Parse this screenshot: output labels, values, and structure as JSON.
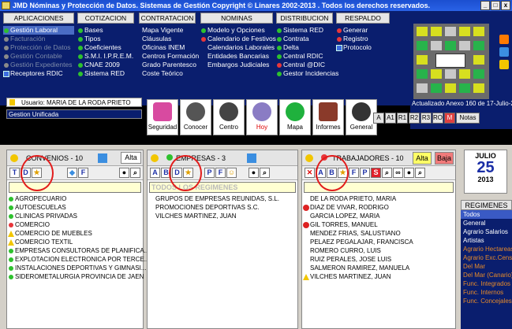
{
  "window": {
    "title": "JMD Nóminas y Protección de Datos. Sistemas de Gestión   Copyright © Linares 2002-2013 . Todos los derechos reservados."
  },
  "menus": [
    {
      "header": "APLICACIONES",
      "items": [
        {
          "label": "Gestión Laboral",
          "state": "selected"
        },
        {
          "label": "Facturación",
          "state": "disabled"
        },
        {
          "label": "Protección de Datos",
          "state": "disabled"
        },
        {
          "label": "Gestión Contable",
          "state": "disabled"
        },
        {
          "label": "Gestión Expedientes",
          "state": "disabled"
        },
        {
          "label": "Receptores RDIC",
          "state": "normal"
        }
      ]
    },
    {
      "header": "COTIZACION",
      "items": [
        {
          "label": "Bases"
        },
        {
          "label": "Tipos"
        },
        {
          "label": "Coeficientes"
        },
        {
          "label": "S.M.I. I.P.R.E.M."
        },
        {
          "label": "CNAE 2009"
        },
        {
          "label": "Sistema RED"
        }
      ]
    },
    {
      "header": "CONTRATACION",
      "items": [
        {
          "label": "Mapa Vigente"
        },
        {
          "label": "Cláusulas"
        },
        {
          "label": "Oficinas INEM"
        },
        {
          "label": "Centros Formación"
        },
        {
          "label": "Grado Parentesco"
        },
        {
          "label": "Coste Teórico"
        }
      ]
    },
    {
      "header": "NOMINAS",
      "items": [
        {
          "label": "Modelo y Opciones"
        },
        {
          "label": "Calendario de Festivos"
        },
        {
          "label": "Calendarios Laborales"
        },
        {
          "label": "Entidades Bancarias"
        },
        {
          "label": "Embargos Judiciales"
        }
      ]
    },
    {
      "header": "DISTRIBUCION",
      "items": [
        {
          "label": "Sistema RED"
        },
        {
          "label": "Contrata"
        },
        {
          "label": "Delta"
        },
        {
          "label": "Central  RDIC"
        },
        {
          "label": "Central  @DIC"
        },
        {
          "label": "Gestor Incidencias"
        }
      ]
    },
    {
      "header": "RESPALDO",
      "items": [
        {
          "label": "Generar"
        },
        {
          "label": "Registro"
        },
        {
          "label": "Protocolo"
        }
      ]
    }
  ],
  "user": {
    "label": "Usuario: MARIA DE LA RODA PRIETO"
  },
  "company": "Gestion Unificada",
  "toolbar": [
    {
      "label": "Seguridad"
    },
    {
      "label": "Conocer"
    },
    {
      "label": "Centro"
    },
    {
      "label": "Hoy"
    },
    {
      "label": "Mapa"
    },
    {
      "label": "Informes"
    },
    {
      "label": "General"
    }
  ],
  "annex": "Actualizado Anexo 160 de 17-Julio-2013",
  "rightbuttons": [
    "A",
    "A1",
    "R1",
    "R2",
    "R3",
    "RO",
    "M",
    "Notas"
  ],
  "panels": {
    "convenios": {
      "title": "CONVENIOS - 10",
      "alta": "Alta",
      "rows": [
        {
          "t": "AGROPECUARIO",
          "i": "g"
        },
        {
          "t": "AUTOESCUELAS",
          "i": "g"
        },
        {
          "t": "CLINICAS PRIVADAS",
          "i": "g"
        },
        {
          "t": "COMERCIO",
          "i": "r"
        },
        {
          "t": "COMERCIO DE MUEBLES",
          "i": "w"
        },
        {
          "t": "COMERCIO TEXTIL",
          "i": "w"
        },
        {
          "t": "EMPRESAS CONSULTORAS DE PLANIFICA...",
          "i": "g"
        },
        {
          "t": "EXPLOTACION ELECTRONICA POR TERCE...",
          "i": "g"
        },
        {
          "t": "INSTALACIONES DEPORTIVAS Y GIMNASI...",
          "i": "g"
        },
        {
          "t": "SIDEROMETALURGIA PROVINCIA DE JAEN",
          "i": "g"
        }
      ]
    },
    "empresas": {
      "title": "EMPRESAS - 3",
      "search": "TODOS LOS REGIMENES",
      "rows": [
        {
          "t": "GRUPOS DE EMPRESAS REUNIDAS, S.L."
        },
        {
          "t": "PROMOCIONES DEPORTIVAS S.C."
        },
        {
          "t": "VILCHES MARTINEZ, JUAN"
        }
      ]
    },
    "trabajadores": {
      "title": "TRABAJADORES - 10",
      "alta": "Alta",
      "baja": "Baja",
      "rows": [
        {
          "t": "DE LA RODA PRIETO, MARIA",
          "i": ""
        },
        {
          "t": "DIAZ DE VIVAR, RODRIGO",
          "i": "x"
        },
        {
          "t": "GARCIA LOPEZ, MARIA",
          "i": ""
        },
        {
          "t": "GIL TORRES, MANUEL",
          "i": "x"
        },
        {
          "t": "MENDEZ FRIAS, SALUSTIANO",
          "i": ""
        },
        {
          "t": "PELAEZ PEGALAJAR, FRANCISCA",
          "i": ""
        },
        {
          "t": "ROMERO CURRO, LUIS",
          "i": ""
        },
        {
          "t": "RUIZ PERALES, JOSE LUIS",
          "i": ""
        },
        {
          "t": "SALMERON RAMIREZ, MANUELA",
          "i": ""
        },
        {
          "t": "VILCHES MARTINEZ, JUAN",
          "i": "w"
        }
      ]
    }
  },
  "calendar": {
    "month": "JULIO",
    "day": "25",
    "year": "2013"
  },
  "regimenes": {
    "header": "REGIMENES",
    "items": [
      {
        "t": "Todos",
        "s": "sel"
      },
      {
        "t": "General",
        "s": ""
      },
      {
        "t": "Agrario Salarios",
        "s": ""
      },
      {
        "t": "Artistas",
        "s": ""
      },
      {
        "t": "Agrario Hectareas",
        "s": "or"
      },
      {
        "t": "Agrario Exc.Censo",
        "s": "or"
      },
      {
        "t": "Del Mar",
        "s": "or"
      },
      {
        "t": "Del Mar (Canario)",
        "s": "or"
      },
      {
        "t": "Func. Integrados",
        "s": "or"
      },
      {
        "t": "Func. Internos",
        "s": "or"
      },
      {
        "t": "Func. Concejales",
        "s": "or"
      }
    ]
  }
}
